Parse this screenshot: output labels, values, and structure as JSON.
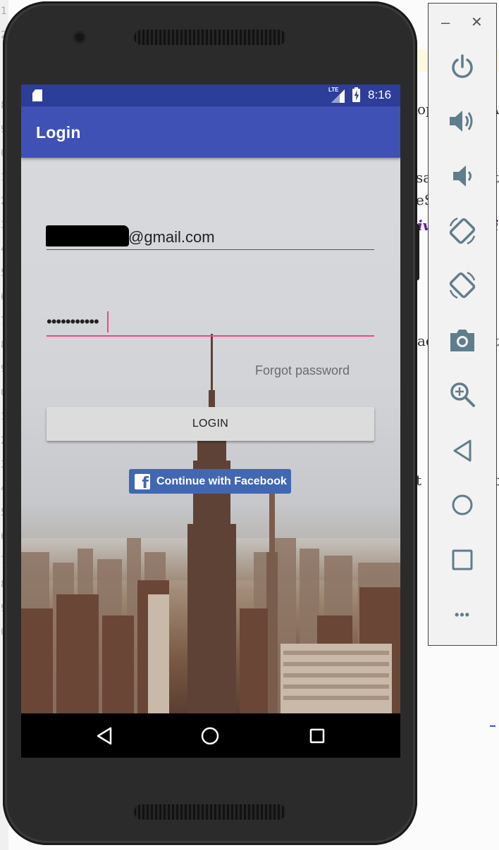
{
  "background_editor": {
    "line_numbers": [
      "1",
      "2",
      "8",
      "9",
      "0",
      "1",
      "2",
      "3",
      "4",
      "5",
      "6",
      "7",
      "8",
      "9",
      "0",
      "1",
      "2",
      "3",
      "4",
      "5",
      "6",
      "7",
      "8",
      "9",
      "0"
    ],
    "snippets": [
      "op",
      "A",
      "sa",
      "t",
      "eS",
      "iv",
      "i",
      "ac",
      "t",
      "t",
      "C",
      "o"
    ]
  },
  "status_bar": {
    "network": "LTE",
    "time": "8:16"
  },
  "app_bar": {
    "title": "Login"
  },
  "login_form": {
    "email_value": "@gmail.com",
    "password_value": "•••••••••••",
    "forgot_password": "Forgot password",
    "login_button": "LOGIN",
    "facebook_button": "Continue with Facebook"
  },
  "nav_bar": {
    "icons": [
      "back-icon",
      "home-icon",
      "recents-icon"
    ]
  },
  "emulator_toolbar": {
    "minimize": "–",
    "close": "✕",
    "icons": [
      "power-icon",
      "volume-up-icon",
      "volume-down-icon",
      "rotate-left-icon",
      "rotate-right-icon",
      "camera-icon",
      "zoom-icon",
      "back-icon",
      "home-icon",
      "overview-icon",
      "more-icon"
    ],
    "more_glyph": "•••"
  },
  "colors": {
    "status_bar": "#2d3d9a",
    "app_bar": "#3f51b5",
    "accent": "#ff4081",
    "facebook": "#4267b2",
    "toolbar_icon": "#607d8b"
  }
}
